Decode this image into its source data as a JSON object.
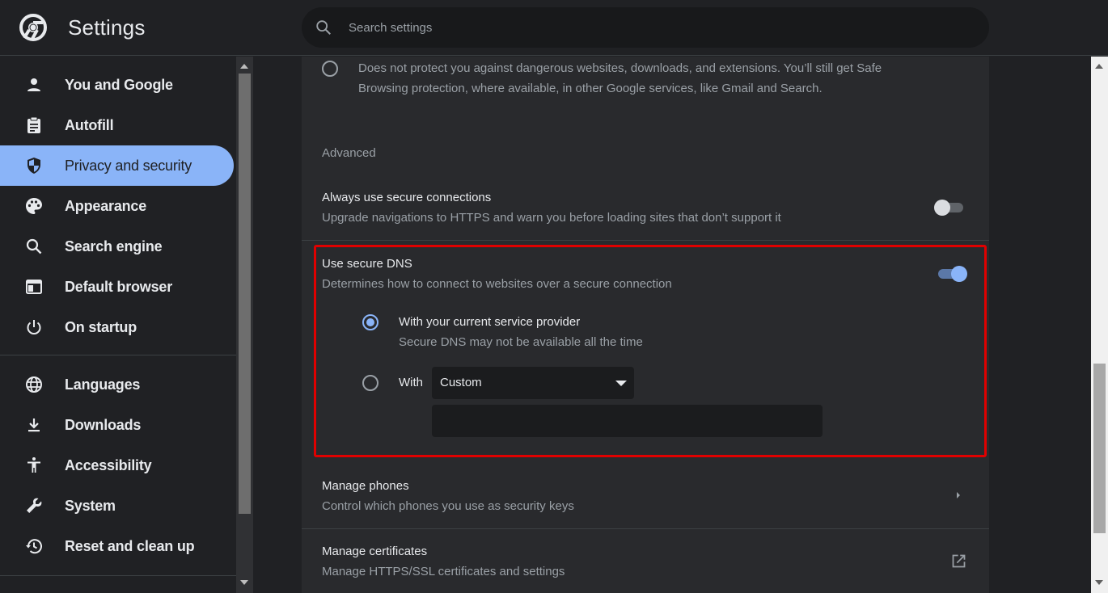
{
  "header": {
    "title": "Settings",
    "search_placeholder": "Search settings"
  },
  "sidebar": {
    "items": [
      {
        "label": "You and Google",
        "icon": "person-icon"
      },
      {
        "label": "Autofill",
        "icon": "clipboard-icon"
      },
      {
        "label": "Privacy and security",
        "icon": "shield-icon",
        "active": true
      },
      {
        "label": "Appearance",
        "icon": "palette-icon"
      },
      {
        "label": "Search engine",
        "icon": "search-icon"
      },
      {
        "label": "Default browser",
        "icon": "browser-window-icon"
      },
      {
        "label": "On startup",
        "icon": "power-icon"
      },
      {
        "label": "Languages",
        "icon": "globe-icon"
      },
      {
        "label": "Downloads",
        "icon": "download-icon"
      },
      {
        "label": "Accessibility",
        "icon": "accessibility-icon"
      },
      {
        "label": "System",
        "icon": "wrench-icon"
      },
      {
        "label": "Reset and clean up",
        "icon": "restore-icon"
      }
    ]
  },
  "main": {
    "no_protection": {
      "desc_line1": "Does not protect you against dangerous websites, downloads, and extensions. You’ll still get Safe",
      "desc_line2": "Browsing protection, where available, in other Google services, like Gmail and Search."
    },
    "advanced_heading": "Advanced",
    "https": {
      "title": "Always use secure connections",
      "desc": "Upgrade navigations to HTTPS and warn you before loading sites that don’t support it",
      "enabled": false
    },
    "secure_dns": {
      "title": "Use secure DNS",
      "desc": "Determines how to connect to websites over a secure connection",
      "enabled": true,
      "option_current": {
        "title": "With your current service provider",
        "desc": "Secure DNS may not be available all the time",
        "selected": true
      },
      "option_custom": {
        "label": "With",
        "selected_provider": "Custom",
        "custom_value": ""
      }
    },
    "manage_phones": {
      "title": "Manage phones",
      "desc": "Control which phones you use as security keys"
    },
    "manage_certificates": {
      "title": "Manage certificates",
      "desc": "Manage HTTPS/SSL certificates and settings"
    }
  },
  "colors": {
    "accent": "#8ab4f8",
    "highlight_border": "#e00000",
    "background": "#202124",
    "card": "#292a2d"
  }
}
